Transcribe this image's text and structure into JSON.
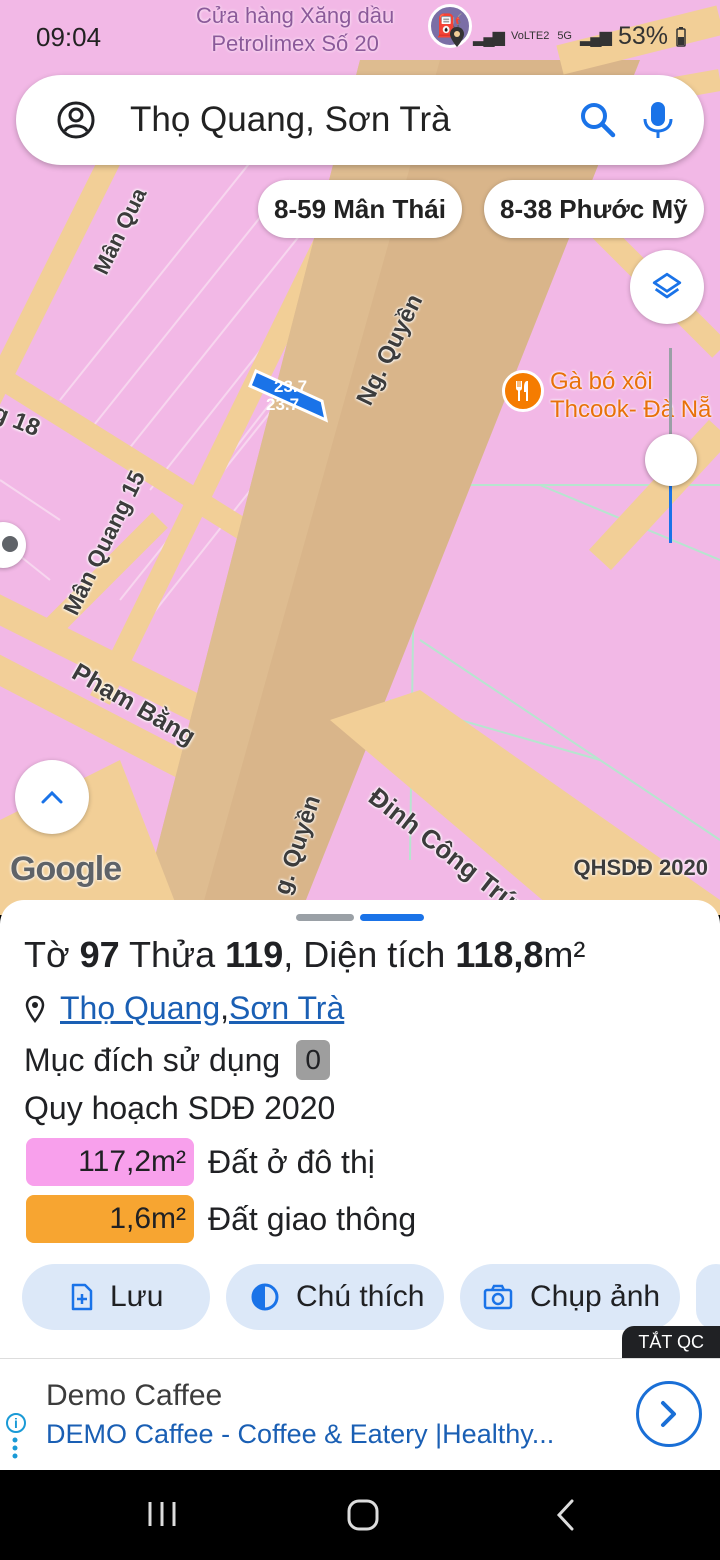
{
  "status_bar": {
    "time": "09:04",
    "network": "VoLTE2",
    "network_type": "5G",
    "battery": "53%"
  },
  "map": {
    "poi_top": {
      "line1": "Cửa hàng Xăng dầu",
      "line2": "Petrolimex Số 20"
    },
    "streets": {
      "man_quang_top": "Mân Qua",
      "man_quang_15": "Mân Quang 15",
      "street_18": "g 18",
      "ng_quyen_top": "Ng. Quyền",
      "ng_quyen_bottom": "g. Quyền",
      "pham_bang": "Phạm Bằng",
      "dinh_cong_tru": "Đinh Công Trứ"
    },
    "parcel_labels": [
      "23.7",
      "23.7"
    ],
    "food_place": {
      "line1": "Gà bó xôi",
      "line2": "Thcook- Đà Nẵ"
    },
    "google_logo": "Google",
    "plan_layer": "QHSDĐ 2020"
  },
  "search": {
    "query": "Thọ Quang, Sơn Trà"
  },
  "address_chips": [
    "8-59 Mân Thái",
    "8-38 Phước Mỹ"
  ],
  "sheet": {
    "title_prefix_1": "Tờ ",
    "sheet_no": "97",
    "title_prefix_2": " Thửa ",
    "parcel_no": "119",
    "title_prefix_3": ", Diện tích ",
    "area": "118,8",
    "area_unit": "m²",
    "ward": "Thọ Quang",
    "separator": ", ",
    "district": "Sơn Trà",
    "usage_label": "Mục đích sử dụng",
    "usage_value": "0",
    "plan_title": "Quy hoạch SDĐ 2020",
    "legend": [
      {
        "area": "117,2m²",
        "label": "Đất ở đô thị",
        "color": "#f8a0ec"
      },
      {
        "area": "1,6m²",
        "label": "Đất giao thông",
        "color": "#f7a531"
      }
    ],
    "actions": {
      "save": "Lưu",
      "notes": "Chú thích",
      "screenshot": "Chụp ảnh"
    }
  },
  "ads_off": "TẮT QC",
  "ad": {
    "title": "Demo Caffee",
    "subtitle": "DEMO Caffee - Coffee & Eatery |Healthy..."
  },
  "colors": {
    "map_pink": "#f2b8e6",
    "road": "#f2cf97",
    "road_main": "#d9b58a",
    "accent_blue": "#1a73e8",
    "chip_bg": "#dce8f8"
  }
}
